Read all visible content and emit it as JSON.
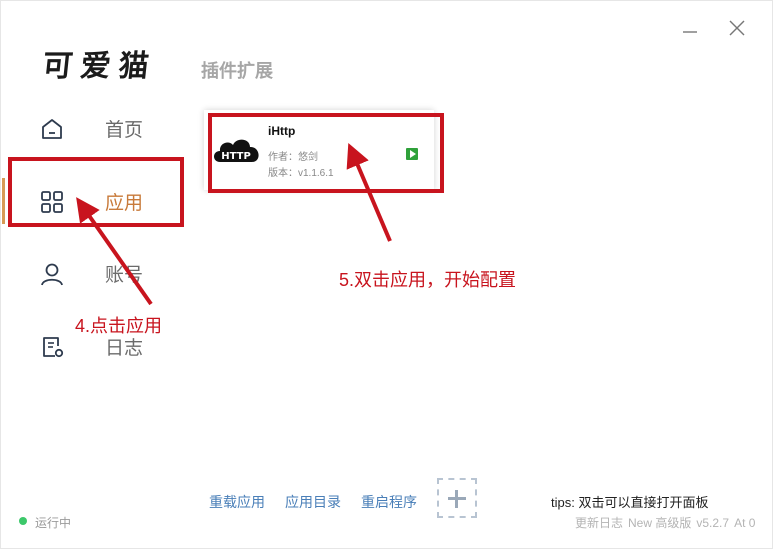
{
  "window": {
    "minimize_icon": "minimize-icon",
    "close_icon": "close-icon"
  },
  "header": {
    "logo_text": "可爱猫",
    "page_title": "插件扩展"
  },
  "sidebar": {
    "items": [
      {
        "label": "首页",
        "icon": "home-icon",
        "active": false
      },
      {
        "label": "应用",
        "icon": "grid-icon",
        "active": true
      },
      {
        "label": "账号",
        "icon": "user-icon",
        "active": false
      },
      {
        "label": "日志",
        "icon": "log-settings-icon",
        "active": false
      }
    ]
  },
  "plugin_card": {
    "logo_text": "HTTP",
    "name": "iHttp",
    "author": "作者：悠剑",
    "version": "版本：v1.1.6.1",
    "status_icon": "play-icon"
  },
  "annotations": {
    "step4": "4.点击应用",
    "step5": "5.双击应用，开始配置"
  },
  "footer": {
    "links": [
      "重载应用",
      "应用目录",
      "重启程序"
    ],
    "add_icon": "plus-icon",
    "tips": "tips: 双击可以直接打开面板",
    "status": "运行中",
    "changelog": "更新日志",
    "edition": "New 高级版",
    "version": "v5.2.7",
    "at_count": "At 0"
  },
  "colors": {
    "accent": "#c87a3a",
    "annotation": "#c8141e",
    "link": "#4a7fb8",
    "status_ok": "#3cc86a"
  }
}
